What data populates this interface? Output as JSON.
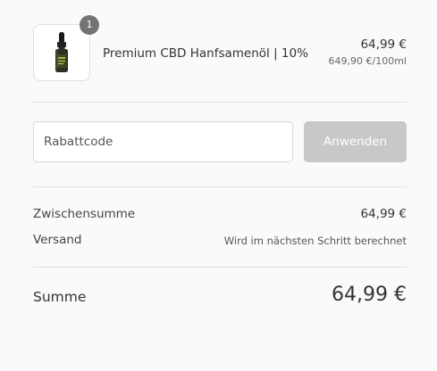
{
  "cart": {
    "item": {
      "quantity": "1",
      "name": "Premium CBD Hanfsamenöl | 10%",
      "price": "64,99 €",
      "unit_price": "649,90 €/100ml"
    }
  },
  "discount": {
    "placeholder": "Rabattcode",
    "apply_label": "Anwenden"
  },
  "totals": {
    "subtotal_label": "Zwischensumme",
    "subtotal_value": "64,99 €",
    "shipping_label": "Versand",
    "shipping_value": "Wird im nächsten Schritt berechnet",
    "total_label": "Summe",
    "total_value": "64,99 €"
  },
  "colors": {
    "badge": "#737373",
    "button_disabled": "#c8c8c8",
    "divider": "#e1e1e1",
    "background": "#fafafa"
  }
}
